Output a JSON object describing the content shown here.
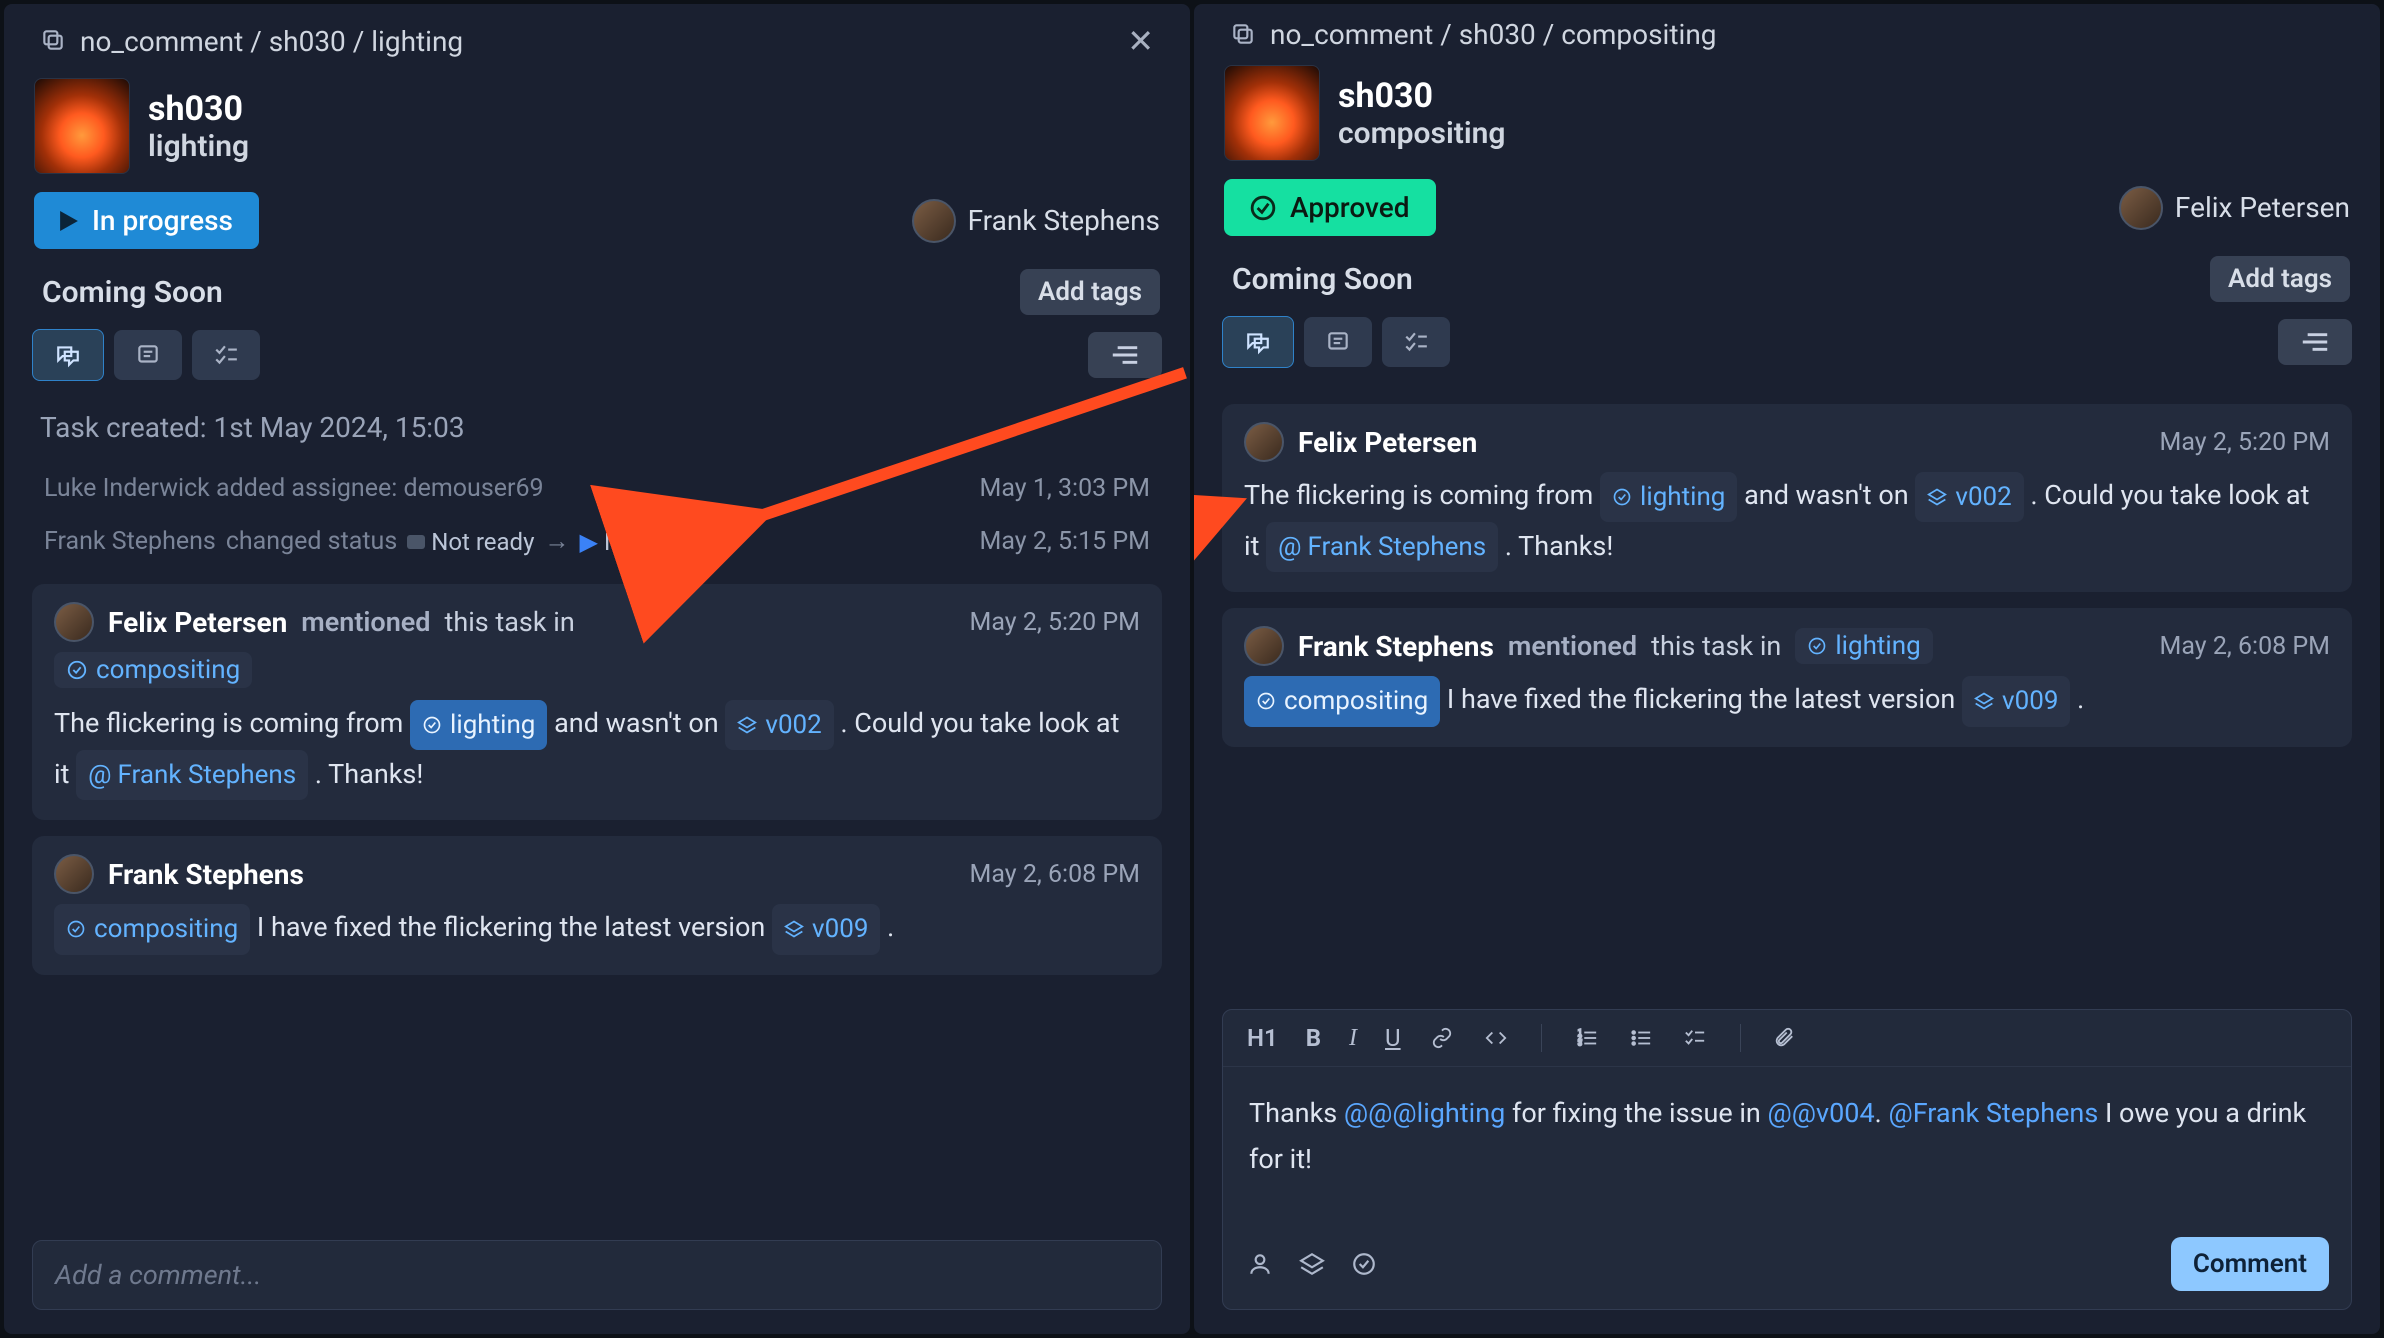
{
  "left": {
    "breadcrumb": "no_comment / sh030 / lighting",
    "shot": "sh030",
    "dept": "lighting",
    "status_label": "In progress",
    "assignee": "Frank Stephens",
    "coming_soon": "Coming Soon",
    "add_tags": "Add tags",
    "task_created": "Task created: 1st May 2024, 15:03",
    "activity1_text": "Luke Inderwick added assignee: demouser69",
    "activity1_ts": "May 1, 3:03 PM",
    "activity2_user": "Frank Stephens",
    "activity2_action": "changed status",
    "activity2_from": "Not ready",
    "activity2_to": "In progress",
    "activity2_ts": "May 2, 5:15 PM",
    "c1_author": "Felix Petersen",
    "c1_verb": "mentioned",
    "c1_verb_rest": "this task in",
    "c1_chip": "compositing",
    "c1_ts": "May 2, 5:20 PM",
    "c1_body_a": "The flickering is coming from",
    "c1_body_lighting": "lighting",
    "c1_body_b": "and wasn't on",
    "c1_body_v": "v002",
    "c1_body_c": ". Could you take look at it",
    "c1_mention": "Frank Stephens",
    "c1_body_d": ". Thanks!",
    "c2_author": "Frank Stephens",
    "c2_ts": "May 2, 6:08 PM",
    "c2_chip": "compositing",
    "c2_body_a": "I have fixed the flickering the latest version",
    "c2_body_v": "v009",
    "c2_body_b": ".",
    "input_placeholder": "Add a comment..."
  },
  "right": {
    "breadcrumb": "no_comment / sh030 / compositing",
    "shot": "sh030",
    "dept": "compositing",
    "status_label": "Approved",
    "assignee": "Felix Petersen",
    "coming_soon": "Coming Soon",
    "add_tags": "Add tags",
    "c1_author": "Felix Petersen",
    "c1_ts": "May 2, 5:20 PM",
    "c1_body_a": "The flickering is coming from",
    "c1_body_lighting": "lighting",
    "c1_body_b": "and wasn't on",
    "c1_body_v": "v002",
    "c1_body_c": ". Could you take look at it",
    "c1_mention": "Frank Stephens",
    "c1_body_d": ". Thanks!",
    "c2_author": "Frank Stephens",
    "c2_verb": "mentioned",
    "c2_verb_rest": "this task in",
    "c2_chip_head": "lighting",
    "c2_ts": "May 2, 6:08 PM",
    "c2_chip": "compositing",
    "c2_body_a": "I have fixed the flickering the latest version",
    "c2_body_v": "v009",
    "c2_body_b": ".",
    "editor_text_a": "Thanks ",
    "editor_m1": "@@@lighting",
    "editor_text_b": " for fixing the issue in ",
    "editor_m2": "@@v004",
    "editor_text_c": ". ",
    "editor_m3": "@Frank Stephens",
    "editor_text_d": " I owe you a drink for it!",
    "comment_btn": "Comment"
  },
  "colors": {
    "accent_blue": "#1f8ad6",
    "accent_green": "#15e0a1",
    "link": "#63b3ff"
  }
}
